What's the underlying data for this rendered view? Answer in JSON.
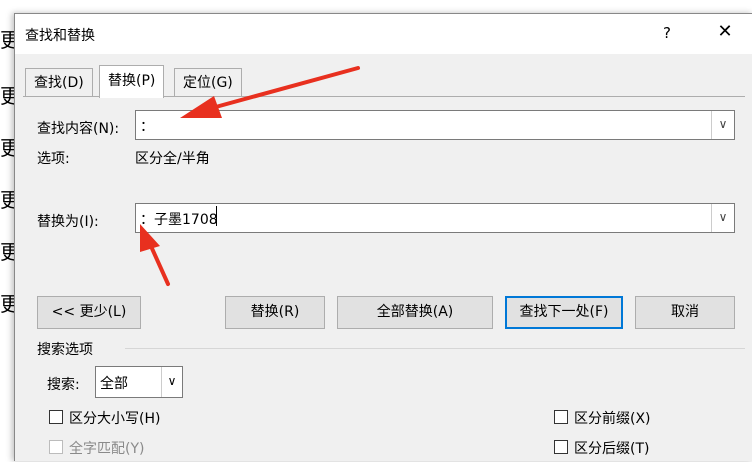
{
  "background": {
    "chars": [
      "更",
      "更",
      "更",
      "更",
      "更",
      "更"
    ]
  },
  "dialog": {
    "title": "查找和替换",
    "help": "?",
    "close": "✕",
    "tabs": [
      "查找(D)",
      "替换(P)",
      "定位(G)"
    ],
    "find_label": "查找内容(N):",
    "find_value": "：",
    "options_label": "选项:",
    "options_value": "区分全/半角",
    "replace_label": "替换为(I):",
    "replace_value": "：子墨1708",
    "buttons": {
      "less": "<< 更少(L)",
      "replace": "替换(R)",
      "replace_all": "全部替换(A)",
      "find_next": "查找下一处(F)",
      "cancel": "取消"
    },
    "search_options_title": "搜索选项",
    "search_label": "搜索:",
    "search_value": "全部",
    "checkboxes": {
      "match_case": "区分大小写(H)",
      "whole_word": "全字匹配(Y)",
      "match_prefix": "区分前缀(X)",
      "match_suffix": "区分后缀(T)"
    }
  },
  "colors": {
    "arrow": "#e8301f",
    "accent": "#0078d7"
  }
}
